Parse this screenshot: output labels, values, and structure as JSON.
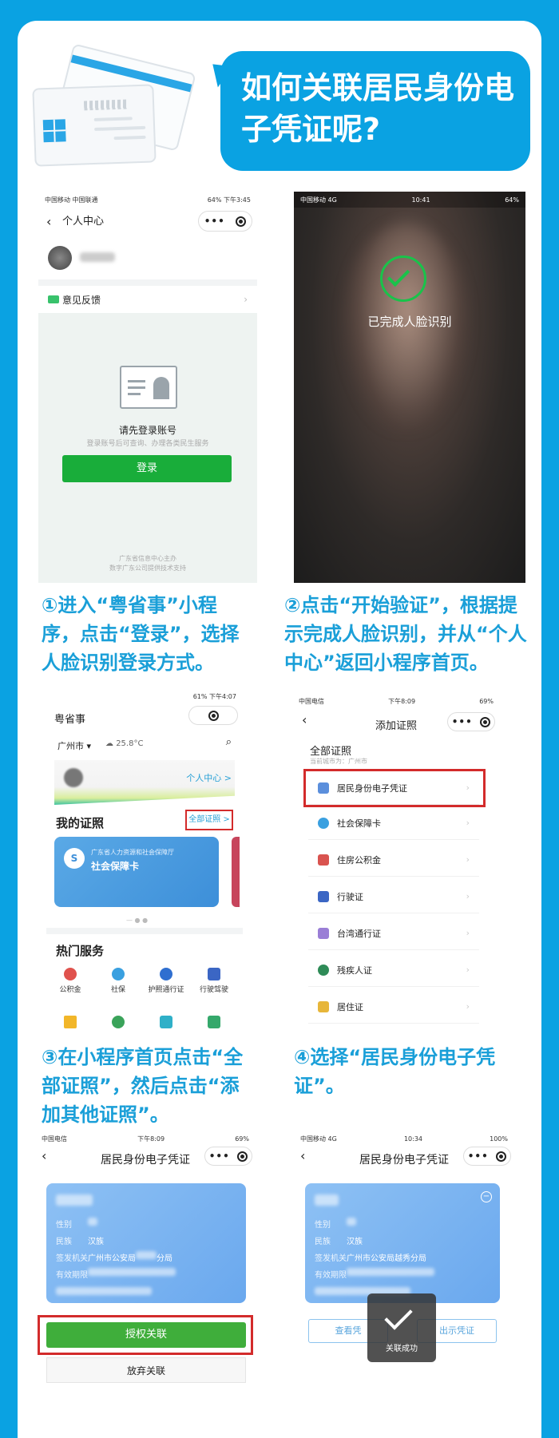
{
  "header": {
    "title": "如何关联居民身份电子凭证呢?"
  },
  "step1": {
    "status_left": "中国移动 中国联通",
    "status_right": "64% 下午3:45",
    "nav_title": "个人中心",
    "feedback": "意见反馈",
    "login_prompt": "请先登录账号",
    "login_sub": "登录账号后可查询、办理各类民生服务",
    "login_button": "登录",
    "footer_1": "广东省信息中心主办",
    "footer_2": "数字广东公司提供技术支持",
    "caption": "①进入“粤省事”小程序，点击“登录”，选择人脸识别登录方式。"
  },
  "step2": {
    "status_left": "中国移动 4G",
    "status_time": "10:41",
    "status_right": "64%",
    "result": "已完成人脸识别",
    "caption": "②点击“开始验证”，根据提示完成人脸识别，并从“个人中心”返回小程序首页。"
  },
  "step3": {
    "status_right": "61% 下午4:07",
    "app_title": "粤省事",
    "city": "广州市 ▾",
    "weather": "25.8°C",
    "personal_center": "个人中心 >",
    "my_certs": "我的证照",
    "all_certs": "全部证照 >",
    "card_issuer": "广东省人力资源和社会保障厅",
    "card_name": "社会保障卡",
    "hot_services": "热门服务",
    "services": [
      "公积金",
      "社保",
      "护照通行证",
      "行驶驾驶"
    ],
    "caption": "③在小程序首页点击“全部证照”，然后点击“添加其他证照”。"
  },
  "step4": {
    "status_left": "中国电信",
    "status_time": "下午8:09",
    "status_right": "69%",
    "nav_title": "添加证照",
    "heading": "全部证照",
    "current_city": "当前城市为：广州市",
    "items": [
      "居民身份电子凭证",
      "社会保障卡",
      "住房公积金",
      "行驶证",
      "台湾通行证",
      "残疾人证",
      "居住证"
    ],
    "caption": "④选择“居民身份电子凭证”。"
  },
  "step5": {
    "status_left": "中国电信",
    "status_time": "下午8:09",
    "status_right": "69%",
    "nav_title": "居民身份电子凭证",
    "labels": {
      "gender": "性别",
      "ethnicity": "民族",
      "authority": "签发机关",
      "valid": "有效期限"
    },
    "ethnicity": "汉族",
    "authority": "广州市公安局",
    "authority_suffix": "分局",
    "authorize": "授权关联",
    "give_up": "放弃关联"
  },
  "step6": {
    "status_left": "中国移动 4G",
    "status_time": "10:34",
    "status_right": "100%",
    "nav_title": "居民身份电子凭证",
    "ethnicity": "汉族",
    "authority": "广州市公安局越秀分局",
    "view": "查看凭",
    "show": "出示凭证",
    "toast": "关联成功"
  },
  "colors": {
    "brand_blue": "#0aa2e2",
    "caption_blue": "#1a9fd8",
    "wechat_green": "#19ad3a",
    "highlight_red": "#d32b2b"
  }
}
